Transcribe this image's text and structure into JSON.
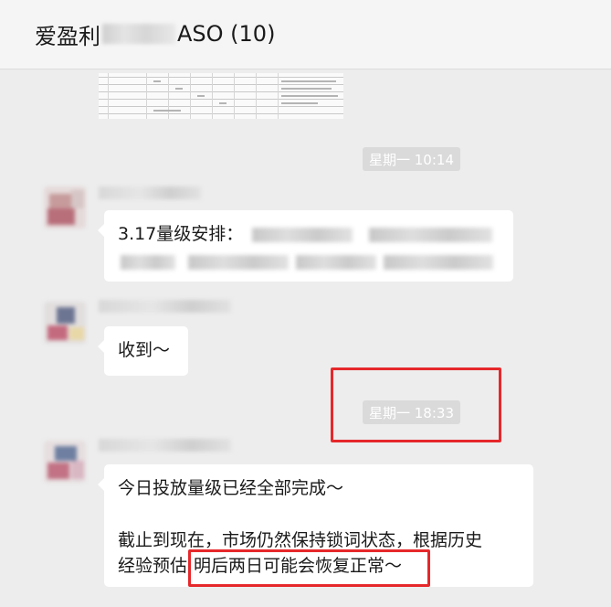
{
  "header": {
    "title_prefix": "爱盈利",
    "title_suffix": "ASO (10)"
  },
  "messages": {
    "time1": "星期一 10:14",
    "msg1_text": "3.17量级安排：",
    "msg2_text": "收到～",
    "time2": "星期一 18:33",
    "msg3_line1": "今日投放量级已经全部完成～",
    "msg3_line2": "截止到现在，市场仍然保持锁词状态，根据历史",
    "msg3_line3_a": "经验预估",
    "msg3_line3_b": "明后两日可能会恢复正常～"
  },
  "colors": {
    "highlight_box": "#e6282b",
    "timestamp_bg": "#dadada",
    "bubble_bg": "#ffffff",
    "chat_bg": "#ededed"
  }
}
